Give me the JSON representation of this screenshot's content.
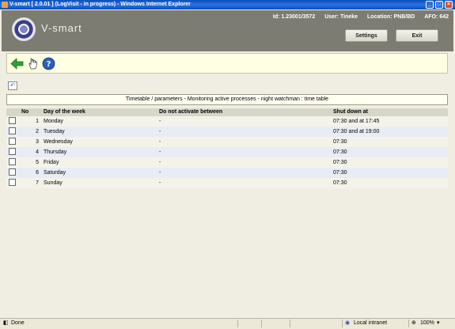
{
  "window": {
    "title": "V-smart [ 2.0.01 ] (LogVisit - in progress) - Windows Internet Explorer"
  },
  "header": {
    "logo_text": "V-smart",
    "id_label": "Id: 1.23001/3572",
    "user_label": "User: Tineke",
    "location_label": "Location: PNB/BD",
    "afo_label": "AFO: 642",
    "settings_label": "Settings",
    "exit_label": "Exit"
  },
  "toolbar": {
    "icons": [
      "back-arrow-icon",
      "hand-pointer-icon",
      "help-icon"
    ]
  },
  "caption": "Timetable / parameters - Monitoring active processes - night watchman : time table",
  "table": {
    "headers": {
      "no": "No",
      "day": "Day of the week",
      "dna": "Do not activate between",
      "shut": "Shut down at"
    },
    "rows": [
      {
        "no": "1",
        "day": "Monday",
        "dna": "-",
        "shut": "07:30 and at 17:45"
      },
      {
        "no": "2",
        "day": "Tuesday",
        "dna": "-",
        "shut": "07:30 and at 19:00"
      },
      {
        "no": "3",
        "day": "Wednesday",
        "dna": "-",
        "shut": "07:30"
      },
      {
        "no": "4",
        "day": "Thursday",
        "dna": "-",
        "shut": "07:30"
      },
      {
        "no": "5",
        "day": "Friday",
        "dna": "-",
        "shut": "07:30"
      },
      {
        "no": "6",
        "day": "Saturday",
        "dna": "-",
        "shut": "07:30"
      },
      {
        "no": "7",
        "day": "Sunday",
        "dna": "-",
        "shut": "07:30"
      }
    ]
  },
  "statusbar": {
    "status": "Done",
    "zone": "Local intranet",
    "zoom": "100%"
  },
  "colors": {
    "titlebar": "#0a4fb8",
    "header": "#7c7c72",
    "toolbar": "#ffffe3",
    "row_alt": "#e8ecf4"
  }
}
